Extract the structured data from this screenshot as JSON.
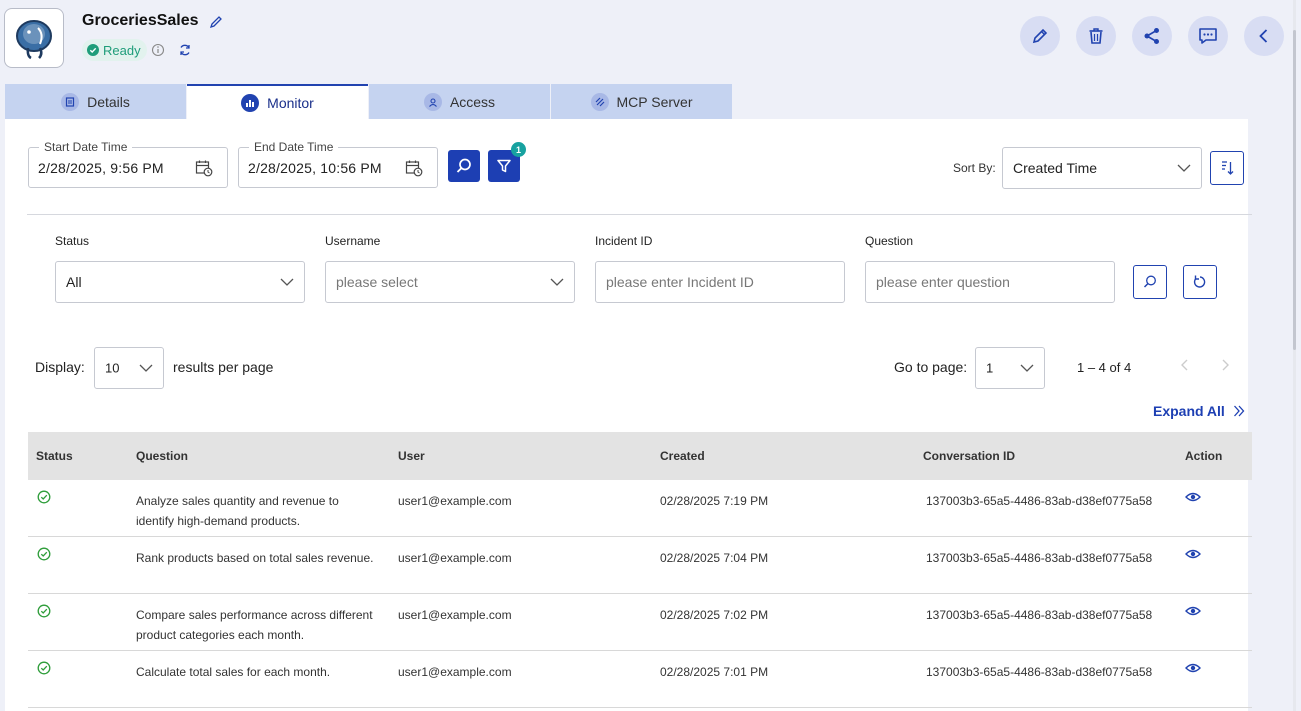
{
  "header": {
    "title": "GroceriesSales",
    "status": "Ready"
  },
  "tabs": [
    {
      "label": "Details",
      "icon": "details-icon"
    },
    {
      "label": "Monitor",
      "icon": "monitor-icon"
    },
    {
      "label": "Access",
      "icon": "access-icon"
    },
    {
      "label": "MCP Server",
      "icon": "mcp-server-icon"
    }
  ],
  "dates": {
    "start_label": "Start Date Time",
    "start_value": "2/28/2025, 9:56 PM",
    "end_label": "End Date Time",
    "end_value": "2/28/2025, 10:56 PM"
  },
  "filter_count": "1",
  "sort": {
    "label": "Sort By:",
    "value": "Created Time"
  },
  "filters": {
    "status_label": "Status",
    "status_value": "All",
    "username_label": "Username",
    "username_placeholder": "please select",
    "incident_label": "Incident ID",
    "incident_placeholder": "please enter Incident ID",
    "question_label": "Question",
    "question_placeholder": "please enter question"
  },
  "pagination": {
    "display_label": "Display:",
    "per_page": "10",
    "per_page_suffix": "results per page",
    "goto_label": "Go to page:",
    "page": "1",
    "range": "1 – 4 of 4"
  },
  "expand_all": "Expand All",
  "table": {
    "columns": [
      "Status",
      "Question",
      "User",
      "Created",
      "Conversation ID",
      "Action"
    ],
    "rows": [
      {
        "question": " Analyze sales quantity and revenue to identify high-demand products.",
        "user": "user1@example.com",
        "created": "02/28/2025 7:19 PM",
        "conversation_id": "137003b3-65a5-4486-83ab-d38ef0775a58"
      },
      {
        "question": " Rank products based on total sales revenue.",
        "user": "user1@example.com",
        "created": "02/28/2025 7:04 PM",
        "conversation_id": "137003b3-65a5-4486-83ab-d38ef0775a58"
      },
      {
        "question": " Compare sales performance across different product categories each month.",
        "user": "user1@example.com",
        "created": "02/28/2025 7:02 PM",
        "conversation_id": "137003b3-65a5-4486-83ab-d38ef0775a58"
      },
      {
        "question": " Calculate total sales for each month.",
        "user": "user1@example.com",
        "created": "02/28/2025 7:01 PM",
        "conversation_id": "137003b3-65a5-4486-83ab-d38ef0775a58"
      }
    ]
  },
  "colors": {
    "primary": "#1d3fb3",
    "ready_green": "#1f9d7a",
    "badge_teal": "#17a2a0",
    "tab_inactive": "#c5d3f0",
    "header_bg": "#eef0f8"
  }
}
